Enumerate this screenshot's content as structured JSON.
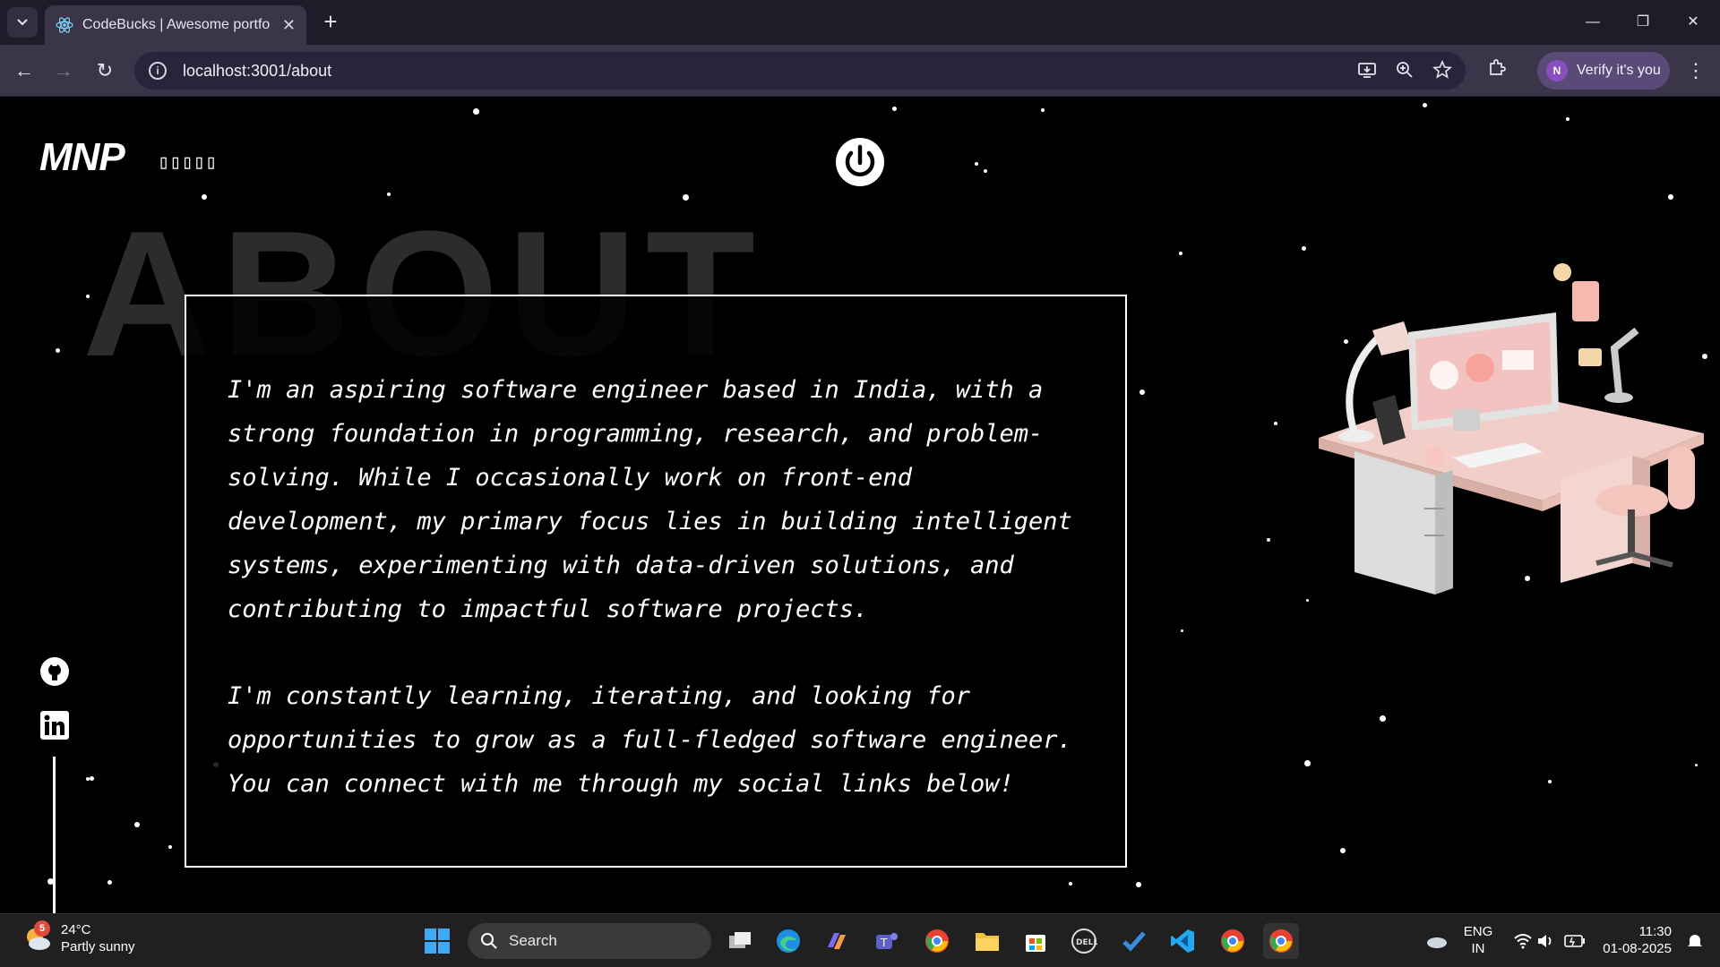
{
  "browser": {
    "tab": {
      "title": "CodeBucks | Awesome portfolio",
      "close": "✕"
    },
    "new_tab": "+",
    "window_controls": {
      "minimize": "—",
      "maximize": "❐",
      "close": "✕"
    },
    "nav": {
      "back": "←",
      "forward": "→",
      "reload": "↻"
    },
    "address": {
      "url": "localhost:3001/about"
    },
    "profile": {
      "initial": "N",
      "label": "Verify it's you"
    },
    "menu": "⋮"
  },
  "page": {
    "logo": "MNP",
    "nav_links": "▯▯▯▯▯",
    "bg_heading": "ABOUT",
    "paragraphs": [
      "I'm an aspiring software engineer based in India, with a\nstrong foundation in programming, research, and problem-\nsolving. While I occasionally work on front-end\ndevelopment, my primary focus lies in building intelligent\nsystems, experimenting with data-driven solutions, and\ncontributing to impactful software projects.",
      "I'm constantly learning, iterating, and looking for\nopportunities to grow as a full-fledged software engineer.\nYou can connect with me through my social links below!"
    ],
    "social": [
      "github-icon",
      "linkedin-icon"
    ]
  },
  "taskbar": {
    "weather": {
      "badge": "5",
      "temp": "24°C",
      "condition": "Partly sunny"
    },
    "search_label": "Search",
    "tray": {
      "lang": "ENG",
      "region": "IN"
    },
    "clock": {
      "time": "11:30",
      "date": "01-08-2025"
    }
  }
}
